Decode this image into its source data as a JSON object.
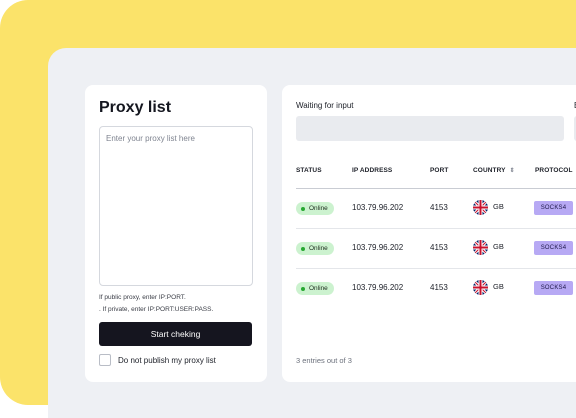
{
  "proxy_panel": {
    "title": "Proxy list",
    "textarea_placeholder": "Enter your proxy list here",
    "hint_public": "If public proxy, enter IP:PORT.",
    "hint_private": ". If private, enter IP:PORT:USER:PASS.",
    "start_button": "Start cheking",
    "publish_checkbox_label": "Do not publish my proxy list",
    "publish_checkbox_checked": false
  },
  "results_panel": {
    "waiting_label": "Waiting for input",
    "right_label_partial": "E",
    "columns": [
      "STATUS",
      "IP ADDRESS",
      "PORT",
      "COUNTRY",
      "PROTOCOL"
    ],
    "sort_icon": "sort-updown-icon",
    "rows": [
      {
        "status": "Online",
        "ip": "103.79.96.202",
        "port": "4153",
        "country_code": "GB",
        "flag_icon": "uk-flag-icon",
        "protocol": "SOCKS4"
      },
      {
        "status": "Online",
        "ip": "103.79.96.202",
        "port": "4153",
        "country_code": "GB",
        "flag_icon": "uk-flag-icon",
        "protocol": "SOCKS4"
      },
      {
        "status": "Online",
        "ip": "103.79.96.202",
        "port": "4153",
        "country_code": "GB",
        "flag_icon": "uk-flag-icon",
        "protocol": "SOCKS4"
      }
    ],
    "entries_text": "3 entries out of 3"
  },
  "colors": {
    "background_accent": "#fbe36a",
    "button_dark": "#15151f",
    "status_online_bg": "#ccf2cf",
    "status_online_dot": "#27a832",
    "protocol_badge": "#b7a9f4"
  }
}
